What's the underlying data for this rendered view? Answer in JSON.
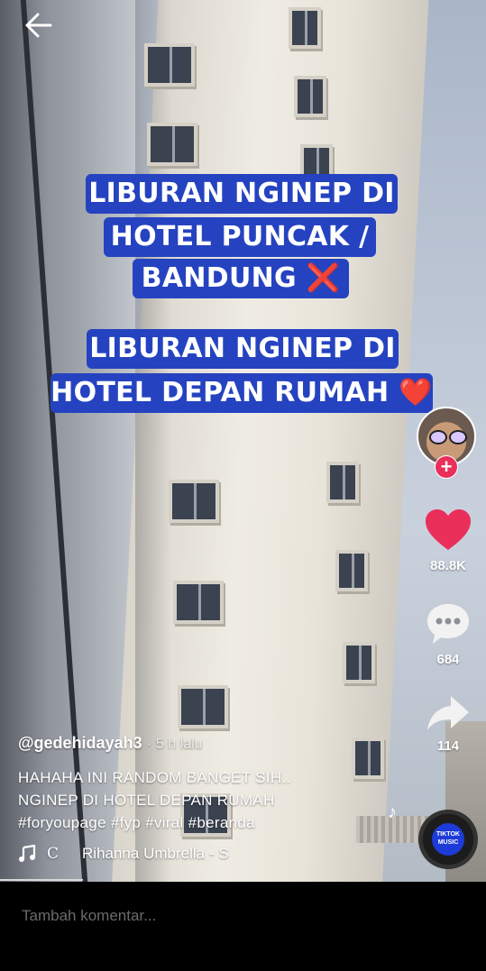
{
  "overlay": {
    "caption_1": [
      "LIBURAN NGINEP DI",
      "HOTEL PUNCAK /",
      "BANDUNG ❌"
    ],
    "caption_2": [
      "LIBURAN NGINEP DI",
      "HOTEL DEPAN RUMAH ❤️"
    ]
  },
  "actions": {
    "follow_symbol": "+",
    "likes": "88.8K",
    "comments": "684",
    "shares": "114"
  },
  "post": {
    "username": "@gedehidayah3",
    "separator": "·",
    "time": "5 h lalu",
    "description_lines": [
      "HAHAHA INI RANDOM BANGET SIH..",
      "NGINEP DI HOTEL DEPAN RUMAH",
      "#foryoupage #fyp #viral #beranda"
    ],
    "music_prefix": "C",
    "music_title": "Rihanna Umbrella - S",
    "disc_label": "TIKTOK MUSIC"
  },
  "comment_bar": {
    "placeholder": "Tambah komentar..."
  },
  "colors": {
    "caption_bg": "#2543c0",
    "like": "#ea2f5a",
    "follow": "#ea2f5a"
  }
}
